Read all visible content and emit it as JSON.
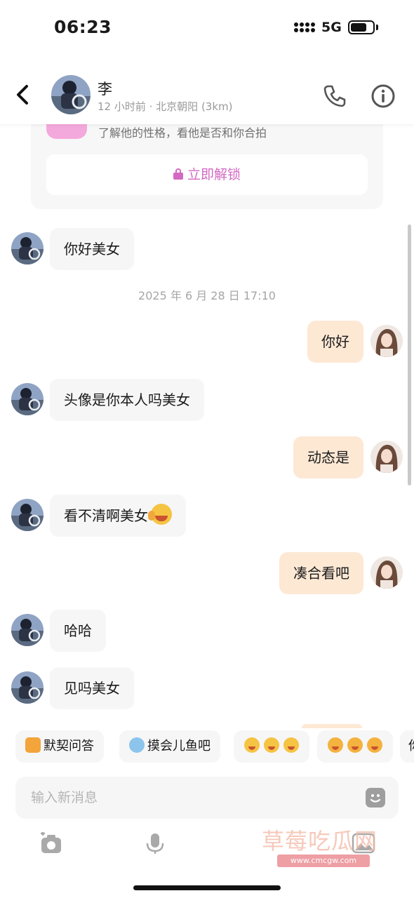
{
  "status_bar": {
    "time": "06:23",
    "network": "5G"
  },
  "header": {
    "name": "李",
    "last_active": "12 小时前",
    "separator": " · ",
    "location": "北京朝阳 (3km)"
  },
  "unlock_card": {
    "description": "了解他的性格，看他是否和你合拍",
    "button_label": "立即解锁"
  },
  "messages": [
    {
      "side": "in",
      "text": "你好美女"
    },
    {
      "side": "out",
      "text": "你好"
    },
    {
      "side": "in",
      "text": "头像是你本人吗美女"
    },
    {
      "side": "out",
      "text": "动态是"
    },
    {
      "side": "in",
      "text": "看不清啊美女"
    },
    {
      "side": "out",
      "text": "凑合看吧"
    },
    {
      "side": "in",
      "text": "哈哈"
    },
    {
      "side": "in",
      "text": "见吗美女"
    }
  ],
  "timestamp": "2025 年 6 月 28 日 17:10",
  "quick_replies": [
    {
      "label": "默契问答",
      "icon": "note-icon"
    },
    {
      "label": "摸会儿鱼吧",
      "icon": "fish-emoji-icon"
    },
    {
      "label": "",
      "icon": "emoji-trio-icon"
    },
    {
      "label": "",
      "icon": "emoji-trio-icon"
    },
    {
      "label": "你",
      "icon": ""
    }
  ],
  "composer": {
    "placeholder": "输入新消息"
  },
  "toolbar": [
    "camera-icon",
    "mic-icon",
    "image-icon"
  ],
  "watermark": {
    "text": "草莓吃瓜网",
    "url": "www.cmcgw.com"
  },
  "colors": {
    "accent": "#d369c2",
    "outgoing_bubble": "#fde8d4",
    "incoming_bubble": "#f6f6f7"
  }
}
